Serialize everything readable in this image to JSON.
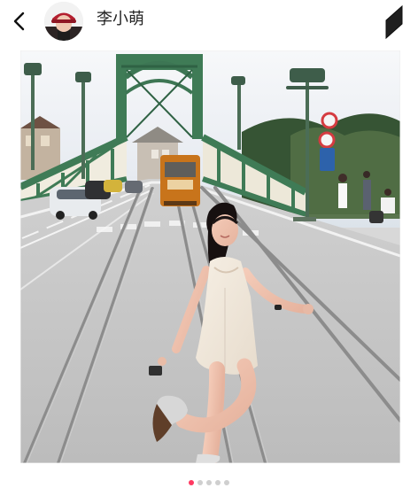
{
  "header": {
    "username": "李小萌"
  },
  "icons": {
    "back": "chevron-left-icon",
    "share": "share-icon"
  },
  "pager": {
    "total": 5,
    "active_index": 0
  },
  "colors": {
    "accent": "#ff3a62",
    "dot_inactive": "#cfcfcf"
  }
}
